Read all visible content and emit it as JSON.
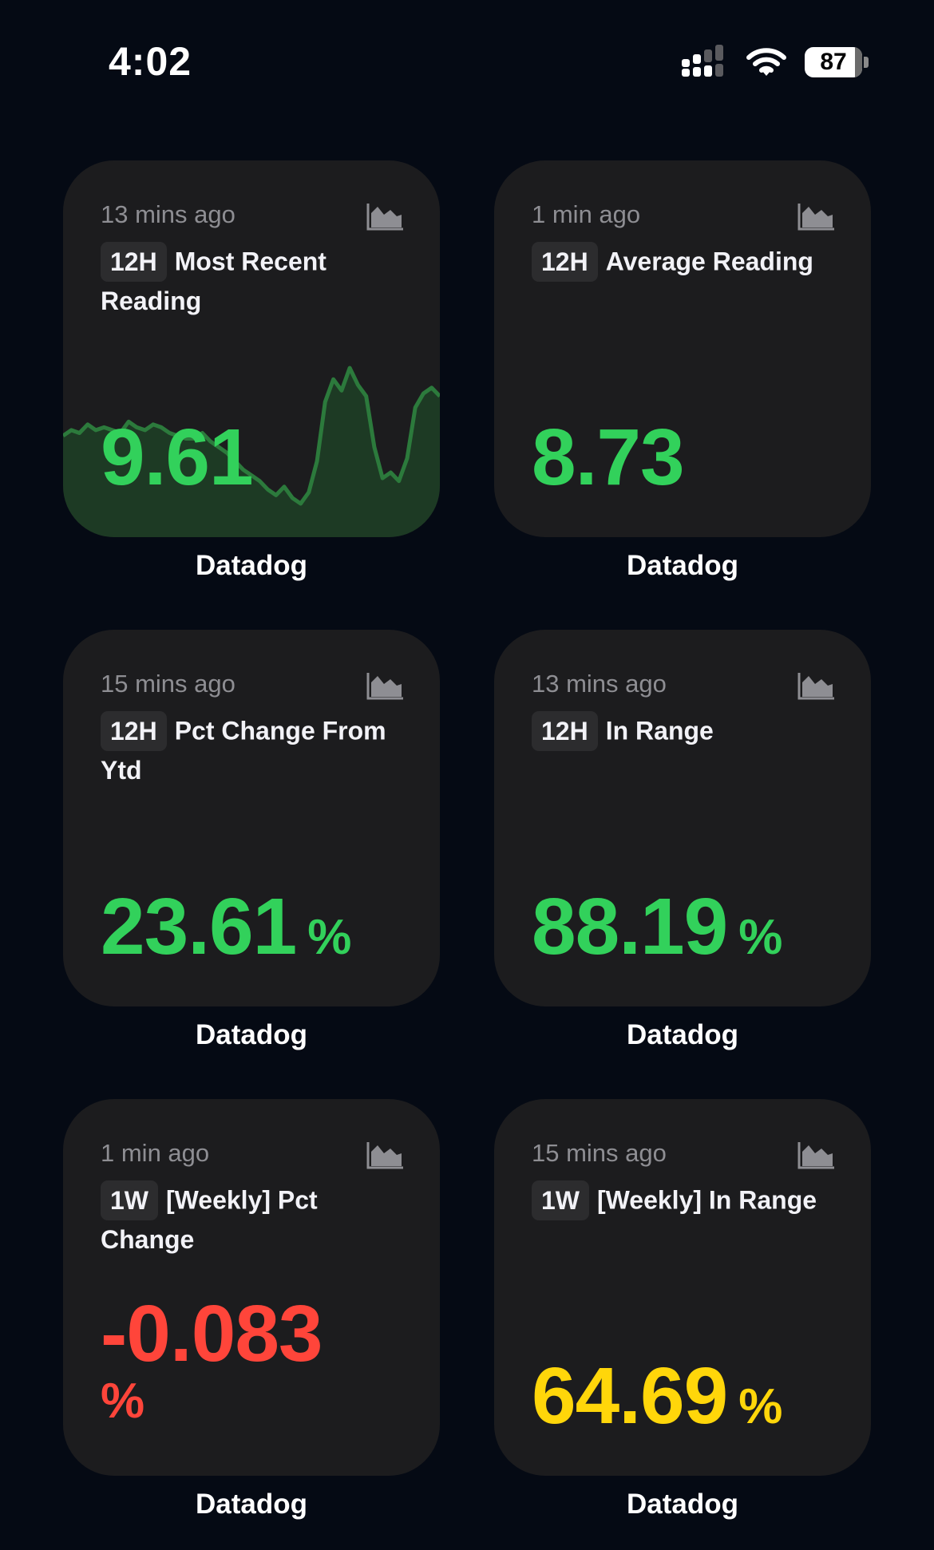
{
  "status_bar": {
    "time": "4:02",
    "battery_level": 87,
    "battery_label": "87"
  },
  "widgets": [
    {
      "ago": "13 mins ago",
      "range": "12H",
      "title": "Most Recent Reading",
      "value": "9.61",
      "unit": "",
      "color": "#32d15b",
      "app": "Datadog",
      "sparkline": [
        7.4,
        7.6,
        7.5,
        7.8,
        7.6,
        7.7,
        7.6,
        7.5,
        7.9,
        7.7,
        7.6,
        7.8,
        7.7,
        7.5,
        7.4,
        7.3,
        7.3,
        7.5,
        7.2,
        7.0,
        6.8,
        6.5,
        6.2,
        6.0,
        5.8,
        5.5,
        5.3,
        5.6,
        5.2,
        5.0,
        5.4,
        6.5,
        8.6,
        9.4,
        9.0,
        9.8,
        9.2,
        8.8,
        7.0,
        5.9,
        6.1,
        5.8,
        6.6,
        8.4,
        8.9,
        9.1,
        8.8
      ]
    },
    {
      "ago": "1 min ago",
      "range": "12H",
      "title": "Average Reading",
      "value": "8.73",
      "unit": "",
      "color": "#32d15b",
      "app": "Datadog"
    },
    {
      "ago": "15 mins ago",
      "range": "12H",
      "title": "Pct Change From Ytd",
      "value": "23.61",
      "unit": "%",
      "color": "#32d15b",
      "app": "Datadog"
    },
    {
      "ago": "13 mins ago",
      "range": "12H",
      "title": "In Range",
      "value": "88.19",
      "unit": "%",
      "color": "#32d15b",
      "app": "Datadog"
    },
    {
      "ago": "1 min ago",
      "range": "1W",
      "title": "[Weekly] Pct Change",
      "value": "-0.083",
      "unit": "%",
      "color": "#ff453a",
      "app": "Datadog"
    },
    {
      "ago": "15 mins ago",
      "range": "1W",
      "title": "[Weekly] In Range",
      "value": "64.69",
      "unit": "%",
      "color": "#ffd60a",
      "app": "Datadog"
    }
  ],
  "icons": {
    "chart": "area-chart-icon",
    "signal": "cellular-signal-icon",
    "wifi": "wifi-icon",
    "battery": "battery-icon"
  }
}
